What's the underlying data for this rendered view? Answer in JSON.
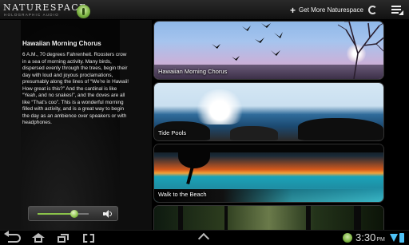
{
  "app": {
    "logo_name": "NATURESPACE",
    "logo_subtitle": "HOLOGRAPHIC AUDIO",
    "get_more_label": "Get More Naturespace"
  },
  "description": {
    "title": "Hawaiian Morning Chorus",
    "body": "6 A.M., 70 degrees Fahrenheit. Roosters crow in a sea of morning activity. Many birds, dispersed evenly through the trees, begin their day with loud and joyous proclamations, presumably along the lines of “We’re in Hawaii! How great is this?” And the cardinal is like “Yeah, and no snakes!”, and the doves are all like “That’s coo”. This is a wonderful morning filled with activity, and is a great way to begin the day as an ambience over speakers or with headphones."
  },
  "player": {
    "volume_fraction": 0.72
  },
  "tracks": [
    {
      "label": "Hawaiian Morning Chorus"
    },
    {
      "label": "Tide Pools"
    },
    {
      "label": "Walk to the Beach"
    },
    {
      "label": ""
    }
  ],
  "status_bar": {
    "time": "3:30",
    "time_suffix": "PM"
  },
  "icons": {
    "logo": "leaf-logo-icon",
    "get_more": "plus-icon",
    "refresh": "refresh-icon",
    "menu": "overflow-menu-icon",
    "volume": "speaker-icon",
    "nav": [
      "back-icon",
      "home-icon",
      "recent-apps-icon",
      "screenshot-icon",
      "up-chevron-icon"
    ],
    "tray": [
      "notification-leaf-icon",
      "wifi-icon",
      "battery-icon"
    ]
  },
  "colors": {
    "accent_green": "#8bc34a",
    "status_blue": "#4fc3f7"
  }
}
